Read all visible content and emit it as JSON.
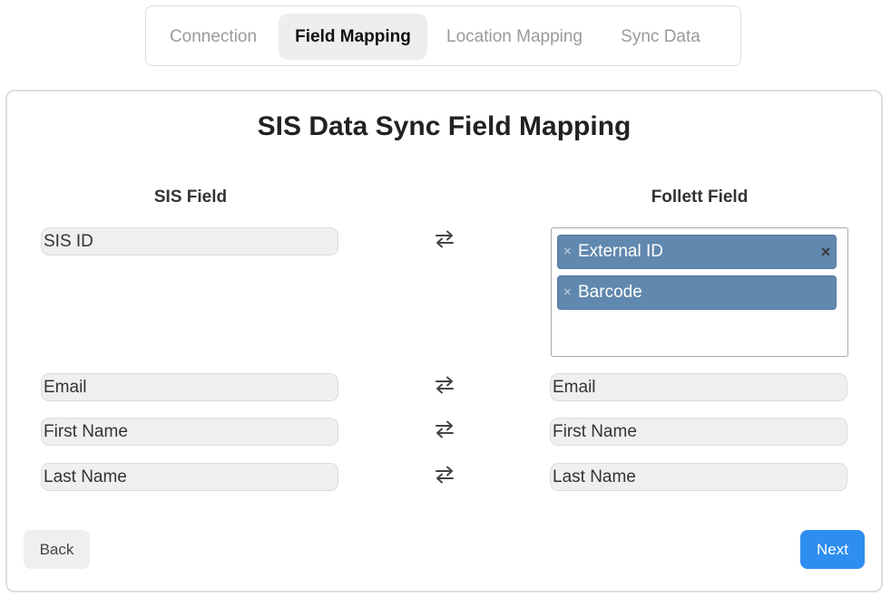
{
  "tabs": [
    {
      "label": "Connection"
    },
    {
      "label": "Field Mapping"
    },
    {
      "label": "Location Mapping"
    },
    {
      "label": "Sync Data"
    }
  ],
  "panel": {
    "title": "SIS Data Sync Field Mapping",
    "sis_header": "SIS Field",
    "follett_header": "Follett Field"
  },
  "rows": [
    {
      "sis": "SIS ID",
      "follett_chips": [
        "External ID",
        "Barcode"
      ]
    },
    {
      "sis": "Email",
      "follett": "Email"
    },
    {
      "sis": "First Name",
      "follett": "First Name"
    },
    {
      "sis": "Last Name",
      "follett": "Last Name"
    }
  ],
  "icons": {
    "swap": "swap-arrows-icon",
    "chip_remove": "×",
    "clear_all": "×"
  },
  "buttons": {
    "back": "Back",
    "next": "Next"
  },
  "colors": {
    "accent": "#2d8ef0",
    "chip": "#6188ae"
  }
}
